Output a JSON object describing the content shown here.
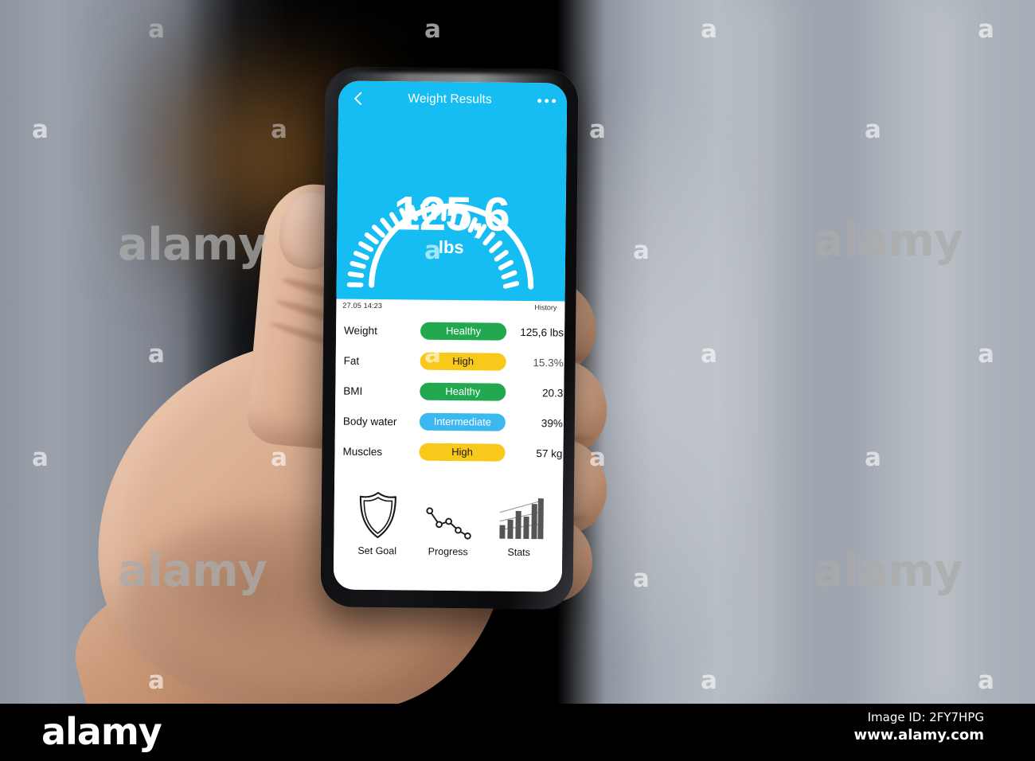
{
  "scene": {
    "description": "hand holding smartphone showing weight scale app"
  },
  "phone": {
    "app": {
      "header": {
        "back_icon": "chevron-left-icon",
        "title": "Weight Results",
        "menu_icon": "more-options-icon"
      },
      "gauge": {
        "value": "125,6",
        "unit": "lbs",
        "accent_color": "#16bdf2",
        "tick_count": 17
      },
      "meta": {
        "timestamp": "27.05  14:23",
        "history_label": "History"
      },
      "metrics_table": {
        "rows": [
          {
            "label": "Weight",
            "status": "Healthy",
            "status_kind": "healthy",
            "value": "125,6 lbs"
          },
          {
            "label": "Fat",
            "status": "High",
            "status_kind": "high",
            "value": "15.3%"
          },
          {
            "label": "BMI",
            "status": "Healthy",
            "status_kind": "healthy",
            "value": "20.3"
          },
          {
            "label": "Body water",
            "status": "Intermediate",
            "status_kind": "intermediate",
            "value": "39%"
          },
          {
            "label": "Muscles",
            "status": "High",
            "status_kind": "high",
            "value": "57 kg"
          }
        ],
        "status_colors": {
          "healthy": "#22a84f",
          "high": "#f8c91b",
          "intermediate": "#3bb8f0"
        }
      },
      "actions": [
        {
          "label": "Set Goal",
          "icon": "shield-icon"
        },
        {
          "label": "Progress",
          "icon": "line-chart-icon"
        },
        {
          "label": "Stats",
          "icon": "bar-chart-icon"
        }
      ]
    }
  },
  "watermark": {
    "glyph": "a",
    "word": "alamy"
  },
  "footer": {
    "logo": "alamy",
    "image_id": "Image ID: 2FY7HPG",
    "url": "www.alamy.com"
  }
}
